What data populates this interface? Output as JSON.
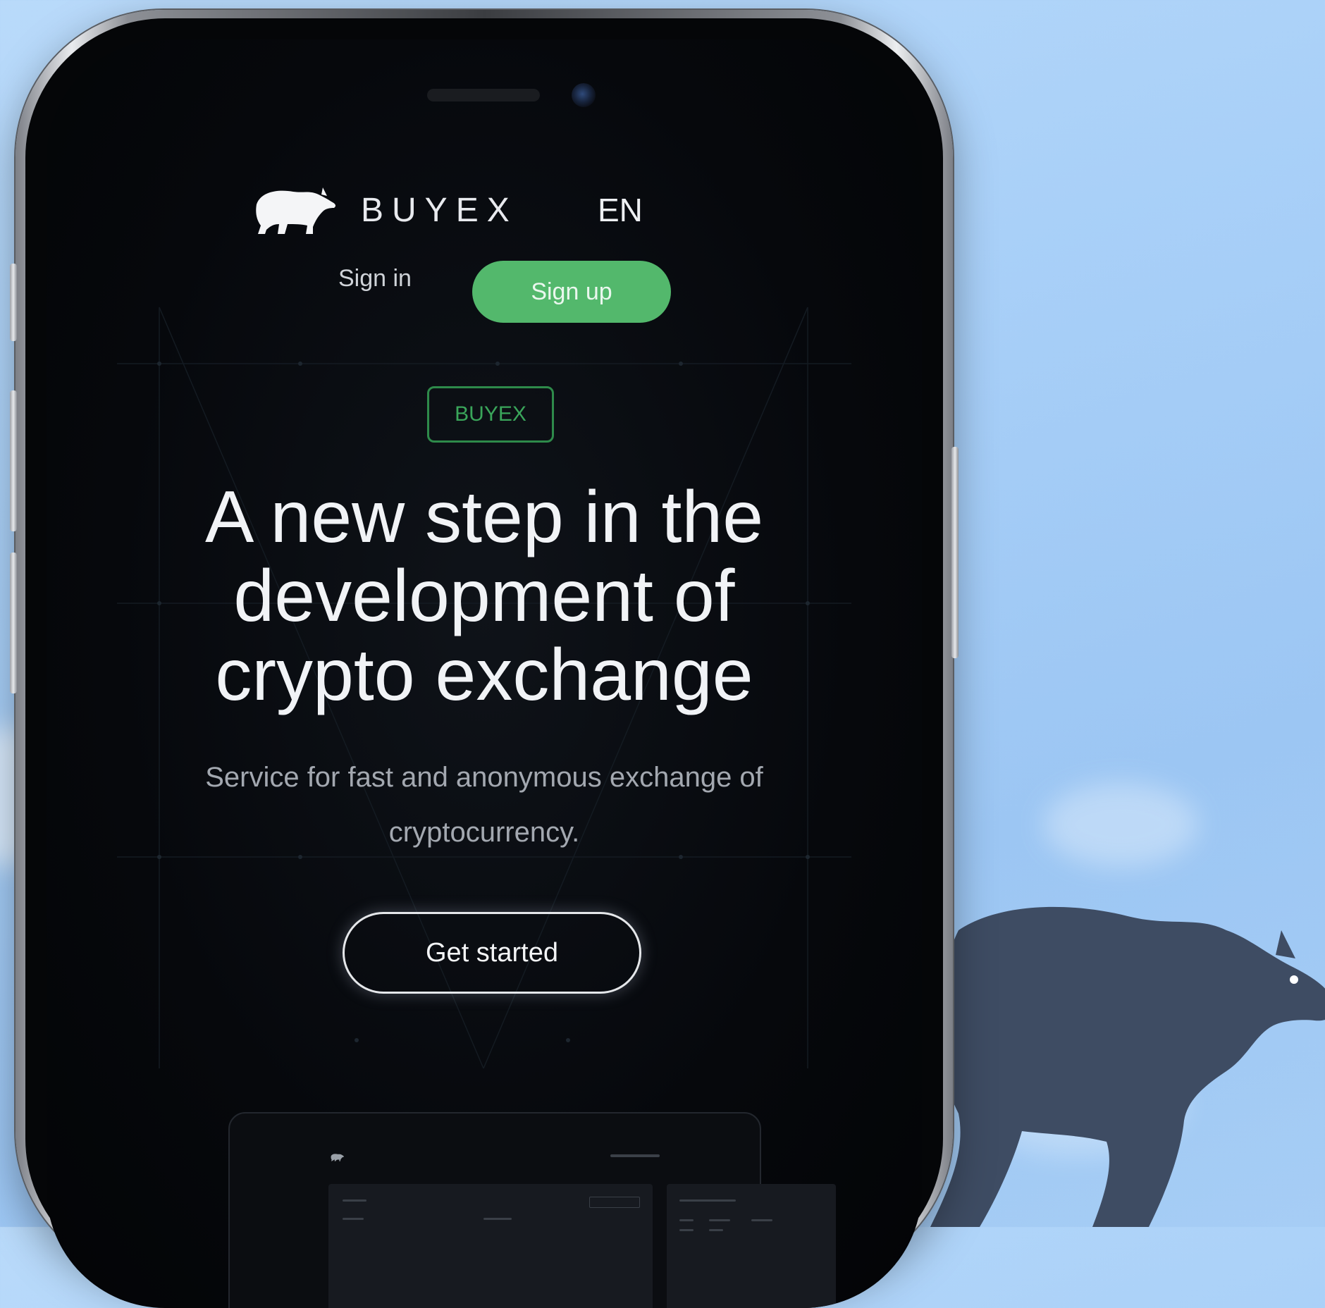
{
  "brand": {
    "name": "BUYEX",
    "logo_icon": "bear-icon"
  },
  "header": {
    "language": "EN",
    "sign_in_label": "Sign in",
    "sign_up_label": "Sign up"
  },
  "hero": {
    "badge": "BUYEX",
    "headline_lines": [
      "A new step in the",
      "development of",
      "crypto exchange"
    ],
    "subtitle": "Service for fast and anonymous exchange of cryptocurrency.",
    "cta_label": "Get started"
  },
  "colors": {
    "background_sky": "#a9d0f8",
    "screen_bg": "#06080c",
    "accent_green": "#53b86c",
    "bear_silhouette": "#3e4c63"
  }
}
